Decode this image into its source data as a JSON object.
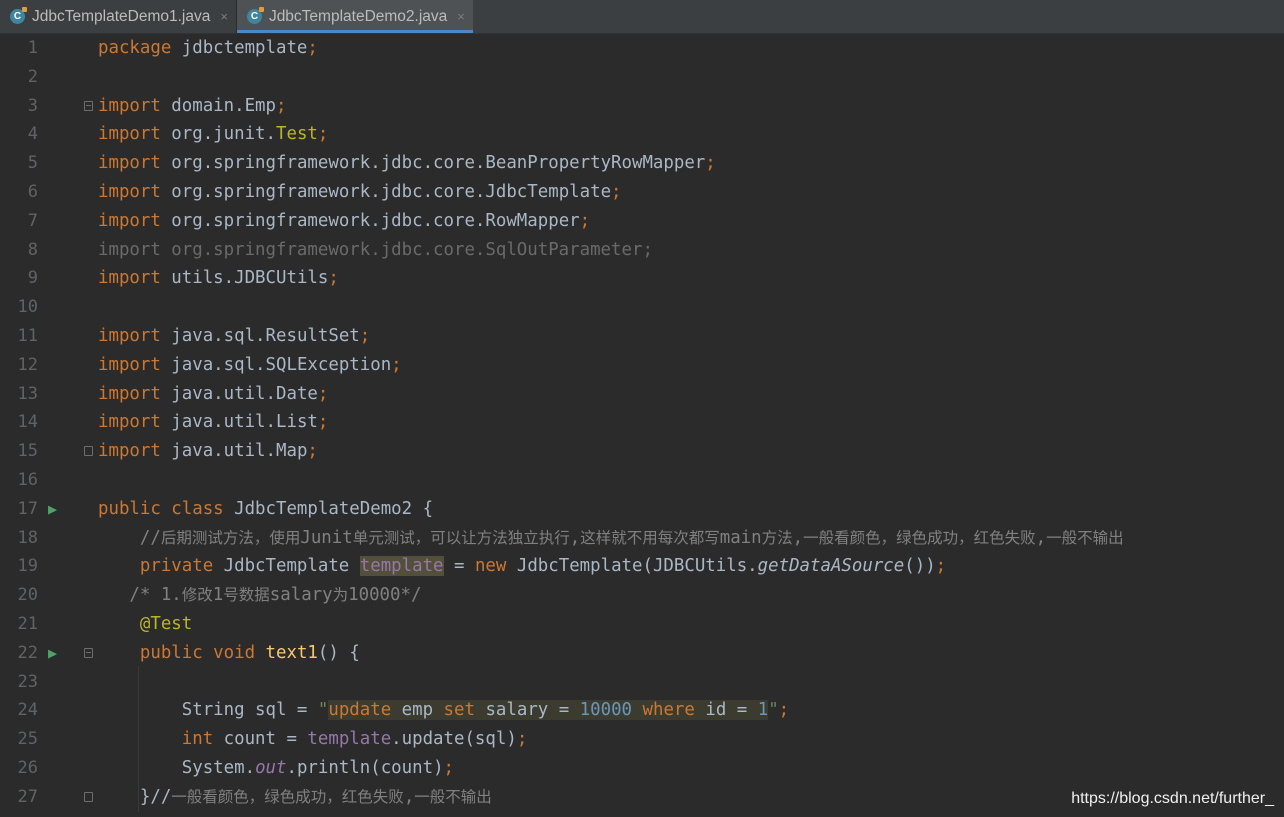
{
  "tabs": [
    {
      "label": "JdbcTemplateDemo1.java",
      "active": false,
      "icon": "java-class-icon"
    },
    {
      "label": "JdbcTemplateDemo2.java",
      "active": true,
      "icon": "java-class-icon"
    }
  ],
  "close_glyph": "×",
  "watermark": "https://blog.csdn.net/further_",
  "lines": {
    "l1": {
      "n": "1",
      "t": [
        "package",
        " jdbctemplate",
        ";"
      ]
    },
    "l2": {
      "n": "2"
    },
    "l3": {
      "n": "3",
      "t": [
        "import",
        " domain.Emp",
        ";"
      ]
    },
    "l4": {
      "n": "4",
      "t": [
        "import",
        " org.junit.",
        "Test",
        ";"
      ]
    },
    "l5": {
      "n": "5",
      "t": [
        "import",
        " org.springframework.jdbc.core.BeanPropertyRowMapper",
        ";"
      ]
    },
    "l6": {
      "n": "6",
      "t": [
        "import",
        " org.springframework.jdbc.core.JdbcTemplate",
        ";"
      ]
    },
    "l7": {
      "n": "7",
      "t": [
        "import",
        " org.springframework.jdbc.core.RowMapper",
        ";"
      ]
    },
    "l8": {
      "n": "8",
      "t": [
        "import org.springframework.jdbc.core.SqlOutParameter;"
      ]
    },
    "l9": {
      "n": "9",
      "t": [
        "import",
        " utils.JDBCUtils",
        ";"
      ]
    },
    "l10": {
      "n": "10"
    },
    "l11": {
      "n": "11",
      "t": [
        "import",
        " java.sql.ResultSet",
        ";"
      ]
    },
    "l12": {
      "n": "12",
      "t": [
        "import",
        " java.sql.SQLException",
        ";"
      ]
    },
    "l13": {
      "n": "13",
      "t": [
        "import",
        " java.util.Date",
        ";"
      ]
    },
    "l14": {
      "n": "14",
      "t": [
        "import",
        " java.util.List",
        ";"
      ]
    },
    "l15": {
      "n": "15",
      "t": [
        "import",
        " java.util.Map",
        ";"
      ]
    },
    "l16": {
      "n": "16"
    },
    "l17": {
      "n": "17",
      "t": [
        "public class",
        " JdbcTemplateDemo2 {"
      ]
    },
    "l18": {
      "n": "18",
      "t": [
        "    //",
        "后期测试方法，使用",
        "Junit",
        "单元测试，可以让方法独立执行",
        ",",
        "这样就不用每次都写",
        "main",
        "方法",
        ",",
        "一般看颜色，绿色成功，红色失败",
        ",",
        "一般不输出"
      ]
    },
    "l19": {
      "n": "19",
      "t": [
        "    private",
        " JdbcTemplate ",
        "template",
        " = ",
        "new",
        " JdbcTemplate(JDBCUtils.",
        "getDataASource",
        "())",
        ";"
      ]
    },
    "l20": {
      "n": "20",
      "t": [
        "   /* 1.",
        "修改",
        "1",
        "号数据",
        "salary",
        "为",
        "10000*/"
      ]
    },
    "l21": {
      "n": "21",
      "t": [
        "    @Test"
      ]
    },
    "l22": {
      "n": "22",
      "t": [
        "    public void",
        " ",
        "text1",
        "() {"
      ]
    },
    "l23": {
      "n": "23"
    },
    "l24": {
      "n": "24",
      "t": [
        "        String sql = ",
        "\"",
        "update",
        " emp ",
        "set",
        " salary = ",
        "10000",
        " ",
        "where",
        " id = ",
        "1",
        "\"",
        ";"
      ]
    },
    "l25": {
      "n": "25",
      "t": [
        "        int",
        " count = ",
        "template",
        ".update(sql)",
        ";"
      ]
    },
    "l26": {
      "n": "26",
      "t": [
        "        System.",
        "out",
        ".println(count)",
        ";"
      ]
    },
    "l27": {
      "n": "27",
      "t": [
        "    }//",
        "一般看颜色，绿色成功，红色失败",
        ",",
        "一般不输出"
      ]
    }
  },
  "gutter_run_icon": "run-test-icon"
}
